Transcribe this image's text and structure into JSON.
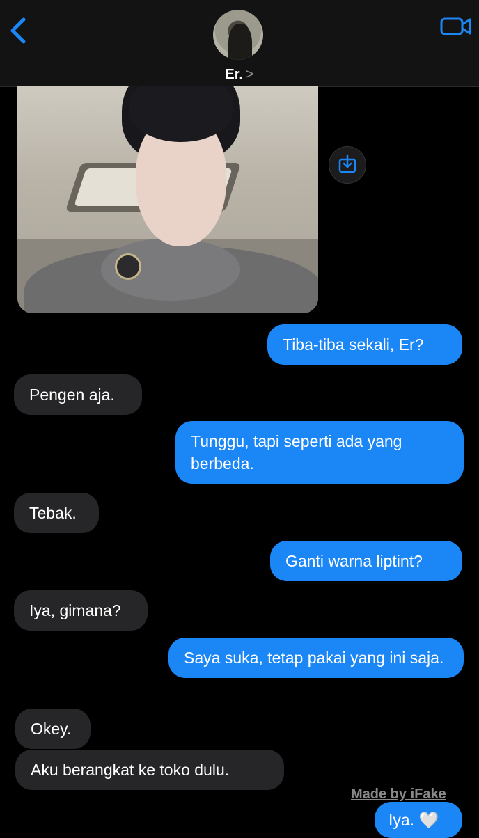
{
  "header": {
    "contact_name": "Er.",
    "chevron": ">",
    "back_icon": "chevron-left-icon",
    "video_icon": "video-camera-icon"
  },
  "attachment": {
    "type": "photo",
    "save_icon": "save-to-files-icon"
  },
  "messages": [
    {
      "side": "out",
      "text": "Tiba-tiba sekali, Er?"
    },
    {
      "side": "in",
      "text": "Pengen aja."
    },
    {
      "side": "out",
      "text": "Tunggu, tapi seperti ada yang berbeda."
    },
    {
      "side": "in",
      "text": "Tebak."
    },
    {
      "side": "out",
      "text": "Ganti warna liptint?"
    },
    {
      "side": "in",
      "text": "Iya, gimana?"
    },
    {
      "side": "out",
      "text": "Saya suka, tetap pakai yang ini saja."
    },
    {
      "side": "in",
      "text": "Okey."
    },
    {
      "side": "in",
      "text": "Aku berangkat ke toko dulu."
    },
    {
      "side": "out",
      "text": "Iya.",
      "emoji": "🤍"
    }
  ],
  "watermark": "Made by iFake",
  "colors": {
    "accent": "#1b86f5",
    "incoming_bubble": "#262628",
    "background": "#000000"
  }
}
